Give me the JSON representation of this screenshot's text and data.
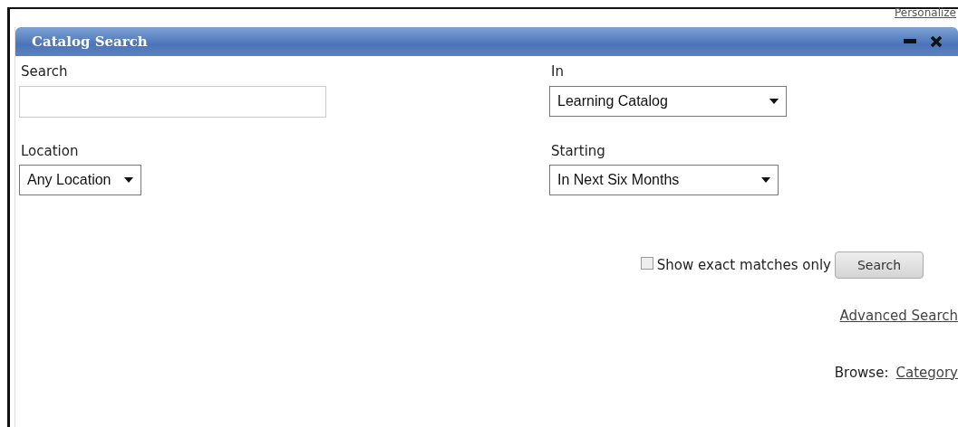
{
  "top_link": "Personalize",
  "panel": {
    "title": "Catalog Search"
  },
  "fields": [
    {
      "kind": "text",
      "label": "Search"
    },
    {
      "kind": "select",
      "label": "In",
      "value": "Learning Catalog"
    },
    {
      "kind": "select",
      "label": "Location",
      "value": "Any Location"
    },
    {
      "kind": "select",
      "label": "Starting",
      "value": "In Next Six Months"
    }
  ],
  "exact_match": {
    "label": "Show exact matches only",
    "checked": false
  },
  "search_button": "Search",
  "advanced_link": "Advanced Search",
  "browse": {
    "label": "Browse:",
    "link": "Category"
  }
}
